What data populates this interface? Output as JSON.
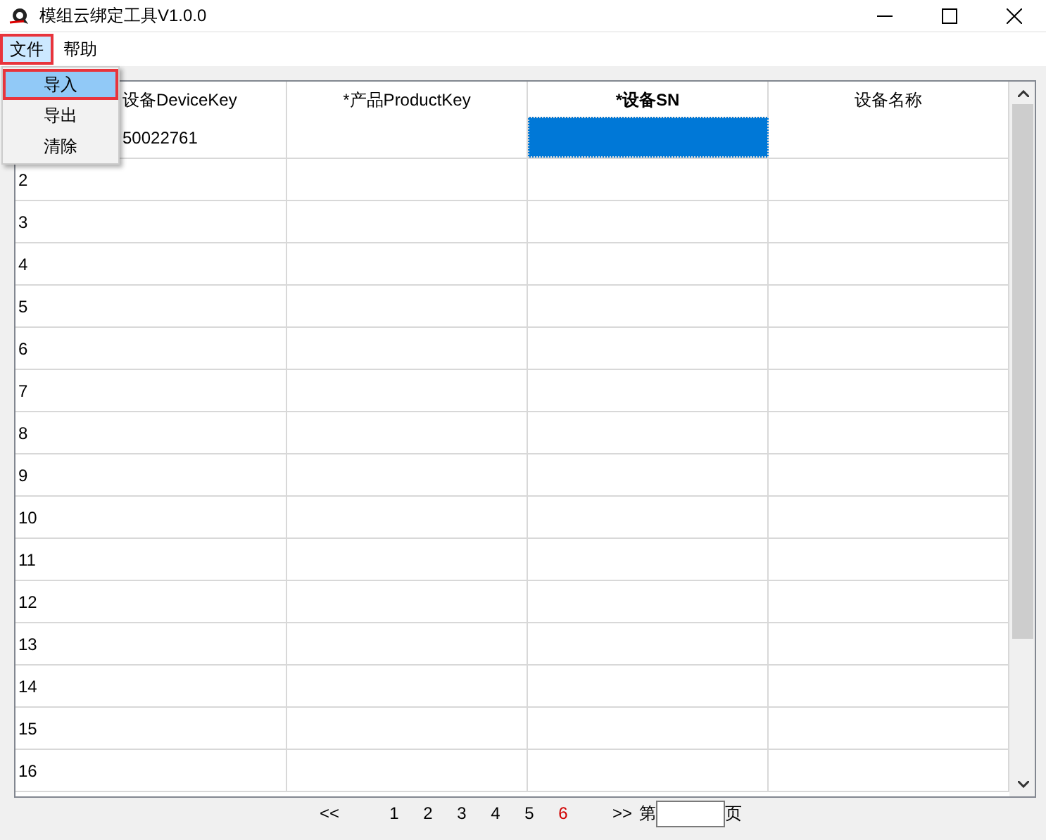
{
  "window": {
    "title": "模组云绑定工具V1.0.0"
  },
  "menu": [
    {
      "label": "文件",
      "selected": true
    },
    {
      "label": "帮助",
      "selected": false
    }
  ],
  "dropdown": [
    {
      "label": "导入",
      "selected": true
    },
    {
      "label": "导出",
      "selected": false
    },
    {
      "label": "清除",
      "selected": false
    }
  ],
  "table": {
    "columns": [
      {
        "label": "设备DeviceKey",
        "selected": false
      },
      {
        "label": "*产品ProductKey",
        "selected": false
      },
      {
        "label": "*设备SN",
        "selected": true
      },
      {
        "label": "设备名称",
        "selected": false
      }
    ],
    "rows": [
      {
        "number": "",
        "cells": [
          "50022761",
          "",
          "",
          ""
        ],
        "selected": [
          false,
          false,
          true,
          false
        ]
      },
      {
        "number": "2",
        "cells": [
          "",
          "",
          "",
          ""
        ]
      },
      {
        "number": "3",
        "cells": [
          "",
          "",
          "",
          ""
        ]
      },
      {
        "number": "4",
        "cells": [
          "",
          "",
          "",
          ""
        ]
      },
      {
        "number": "5",
        "cells": [
          "",
          "",
          "",
          ""
        ]
      },
      {
        "number": "6",
        "cells": [
          "",
          "",
          "",
          ""
        ]
      },
      {
        "number": "7",
        "cells": [
          "",
          "",
          "",
          ""
        ]
      },
      {
        "number": "8",
        "cells": [
          "",
          "",
          "",
          ""
        ]
      },
      {
        "number": "9",
        "cells": [
          "",
          "",
          "",
          ""
        ]
      },
      {
        "number": "10",
        "cells": [
          "",
          "",
          "",
          ""
        ]
      },
      {
        "number": "11",
        "cells": [
          "",
          "",
          "",
          ""
        ]
      },
      {
        "number": "12",
        "cells": [
          "",
          "",
          "",
          ""
        ]
      },
      {
        "number": "13",
        "cells": [
          "",
          "",
          "",
          ""
        ]
      },
      {
        "number": "14",
        "cells": [
          "",
          "",
          "",
          ""
        ]
      },
      {
        "number": "15",
        "cells": [
          "",
          "",
          "",
          ""
        ]
      },
      {
        "number": "16",
        "cells": [
          "",
          "",
          "",
          ""
        ]
      }
    ]
  },
  "pager": {
    "first": "<<",
    "pages": [
      {
        "label": "1",
        "selected": false
      },
      {
        "label": "2",
        "selected": false
      },
      {
        "label": "3",
        "selected": false
      },
      {
        "label": "4",
        "selected": false
      },
      {
        "label": "5",
        "selected": false
      },
      {
        "label": "6",
        "selected": true
      }
    ],
    "last": ">>",
    "prefix": "第",
    "suffix": "页"
  }
}
